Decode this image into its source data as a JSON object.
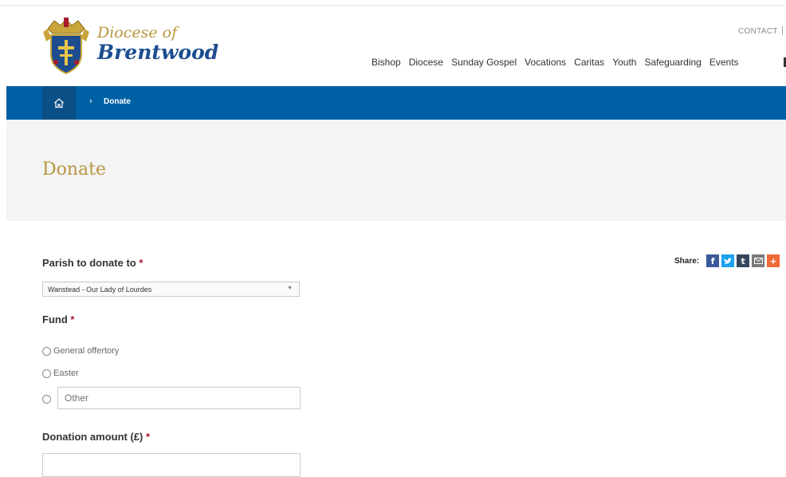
{
  "logo": {
    "line1": "Diocese of",
    "line2": "Brentwood"
  },
  "utility": {
    "contact": "CONTACT"
  },
  "nav": {
    "items": [
      "Bishop",
      "Diocese",
      "Sunday Gospel",
      "Vocations",
      "Caritas",
      "Youth",
      "Safeguarding",
      "Events"
    ]
  },
  "breadcrumb": {
    "separator": "›",
    "current": "Donate",
    "home_icon": "home-icon"
  },
  "page": {
    "title": "Donate"
  },
  "share": {
    "label": "Share:",
    "icons": [
      {
        "name": "facebook-icon",
        "glyph": "f",
        "color": "#3b5998"
      },
      {
        "name": "twitter-icon",
        "glyph": "t",
        "color": "#1da1f2"
      },
      {
        "name": "tumblr-icon",
        "glyph": "t",
        "color": "#35465c"
      },
      {
        "name": "email-icon",
        "glyph": "✉",
        "color": "#7a7a7a"
      },
      {
        "name": "more-icon",
        "glyph": "+",
        "color": "#f06a35"
      }
    ]
  },
  "form": {
    "parish_label": "Parish to donate to",
    "parish_selected": "Wanstead - Our Lady of Lourdes",
    "fund_label": "Fund",
    "fund_options": [
      "General offertory",
      "Easter"
    ],
    "other_placeholder": "Other",
    "amount_label": "Donation amount (£)",
    "amount_value": "",
    "required_mark": "*"
  },
  "colors": {
    "brand_blue": "#0060a5",
    "gold": "#b8963e",
    "required": "#a7192e"
  }
}
